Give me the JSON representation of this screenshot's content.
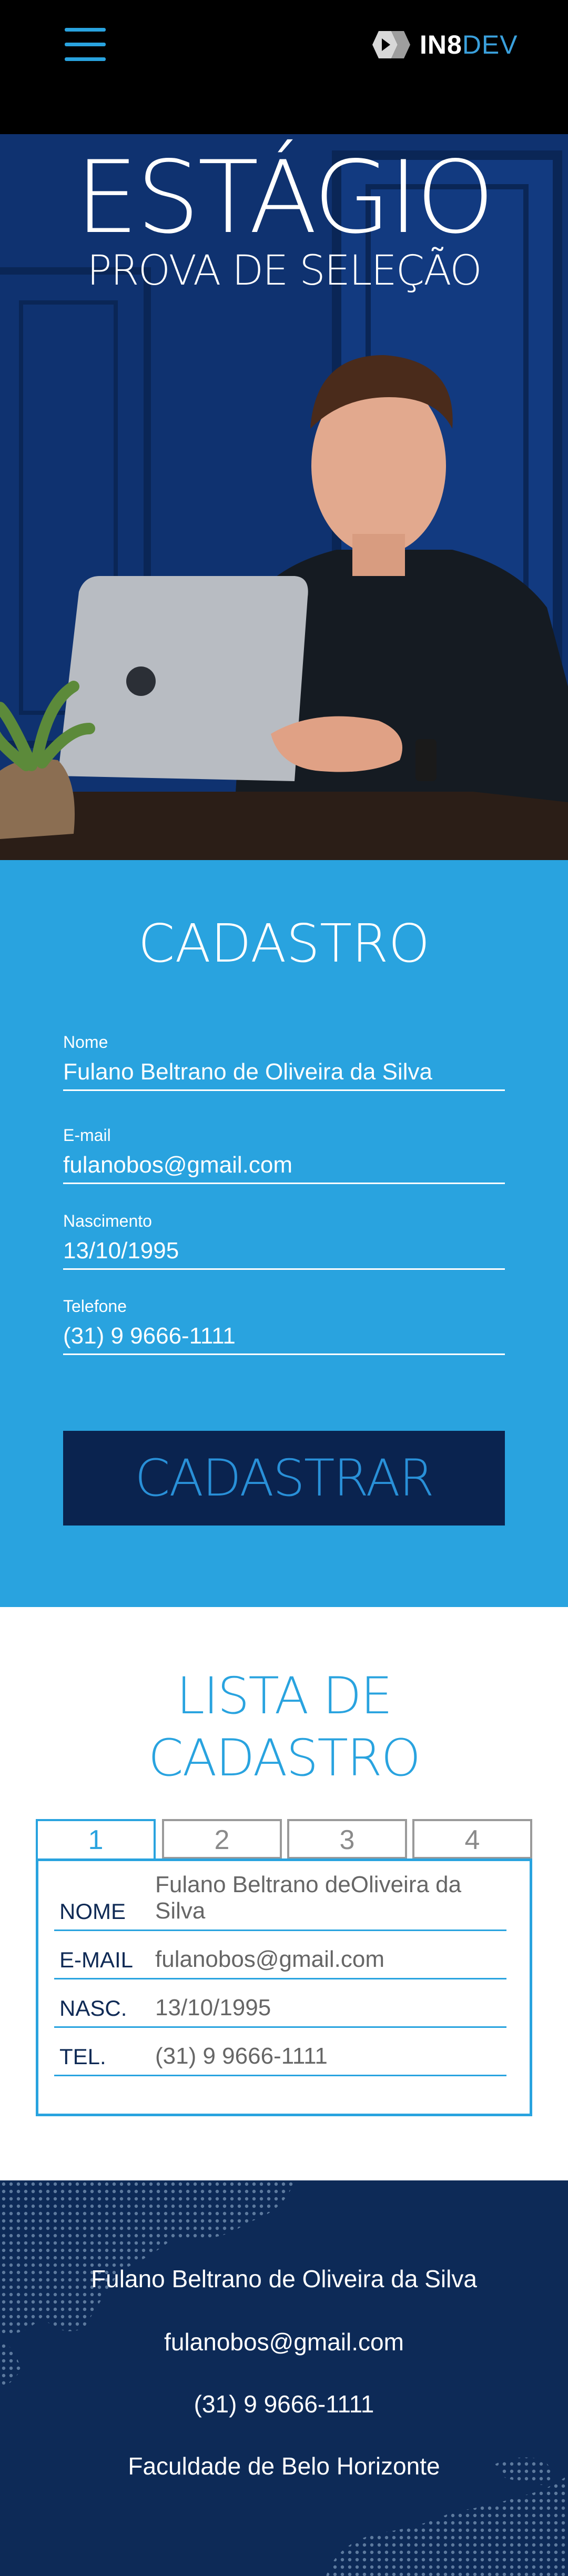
{
  "header": {
    "menu_icon": "hamburger-menu-icon",
    "logo_mark": "IN8",
    "logo_suffix": "DEV"
  },
  "hero": {
    "title": "ESTÁGIO",
    "subtitle": "PROVA DE SELEÇÃO"
  },
  "register": {
    "title": "CADASTRO",
    "fields": [
      {
        "label": "Nome",
        "value": "Fulano Beltrano de Oliveira da Silva"
      },
      {
        "label": "E-mail",
        "value": "fulanobos@gmail.com"
      },
      {
        "label": "Nascimento",
        "value": "13/10/1995"
      },
      {
        "label": "Telefone",
        "value": "(31) 9 9666-1111"
      }
    ],
    "button_label": "CADASTRAR"
  },
  "list": {
    "title_line1": "LISTA DE",
    "title_line2": "CADASTRO",
    "tabs": [
      "1",
      "2",
      "3",
      "4"
    ],
    "rows": [
      {
        "label": "NOME",
        "value": "Fulano Beltrano deOliveira da Silva"
      },
      {
        "label": "E-MAIL",
        "value": "fulanobos@gmail.com"
      },
      {
        "label": "NASC.",
        "value": "13/10/1995"
      },
      {
        "label": "TEL.",
        "value": "(31) 9 9666-1111"
      }
    ]
  },
  "footer": {
    "name": "Fulano Beltrano de Oliveira da Silva",
    "email": "fulanobos@gmail.com",
    "phone": "(31) 9 9666-1111",
    "school": "Faculdade de Belo Horizonte"
  },
  "colors": {
    "accent": "#29a3df",
    "dark_blue": "#0a234f",
    "footer_bg": "#0d2a57"
  }
}
